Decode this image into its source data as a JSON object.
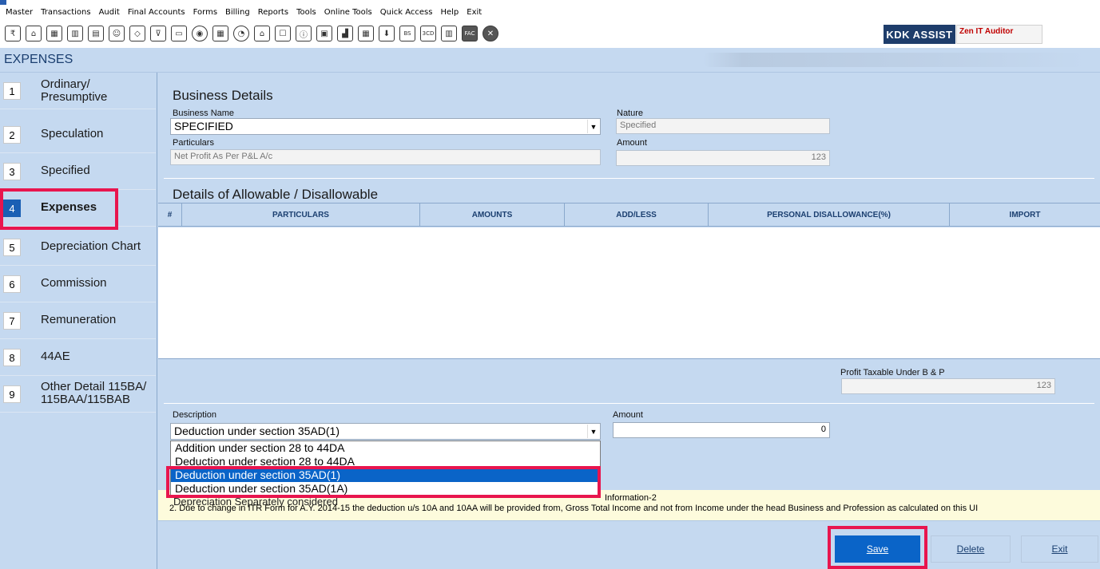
{
  "menu": [
    "Master",
    "Transactions",
    "Audit",
    "Final Accounts",
    "Forms",
    "Billing",
    "Reports",
    "Tools",
    "Online Tools",
    "Quick Access",
    "Help",
    "Exit"
  ],
  "toolbar": {
    "icons": [
      "rupee-icon",
      "home-icon",
      "grid-icon",
      "bar-chart-icon",
      "calendar-icon",
      "users-icon",
      "tag-icon",
      "filter-icon",
      "tax-icon",
      "disc-icon",
      "calculator-icon",
      "pie-icon",
      "pay-icon",
      "document-icon",
      "info-icon",
      "register-icon",
      "report-icon",
      "planner-icon",
      "download-icon",
      "bs-icon",
      "3cd-icon",
      "ledger-icon",
      "fac-icon",
      "close-circle-icon"
    ],
    "icon_glyphs": [
      "₹",
      "⌂",
      "▦",
      "▥",
      "▤",
      "☺",
      "◇",
      "⊽",
      "▭",
      "◉",
      "▦",
      "◔",
      "⌂",
      "☐",
      "ⓘ",
      "▣",
      "▟",
      "▦",
      "⬇",
      "BS",
      "3CD",
      "▥",
      "FAC",
      "✕"
    ],
    "kdk_assist": "KDK ASSIST",
    "zen_auditor": "Zen IT Auditor"
  },
  "page_title": "EXPENSES",
  "sidebar": {
    "items": [
      {
        "num": "1",
        "label": "Ordinary/ Presumptive"
      },
      {
        "num": "2",
        "label": "Speculation"
      },
      {
        "num": "3",
        "label": "Specified"
      },
      {
        "num": "4",
        "label": "Expenses"
      },
      {
        "num": "5",
        "label": "Depreciation Chart"
      },
      {
        "num": "6",
        "label": "Commission"
      },
      {
        "num": "7",
        "label": "Remuneration"
      },
      {
        "num": "8",
        "label": "44AE"
      },
      {
        "num": "9",
        "label": "Other Detail 115BA/ 115BAA/115BAB"
      }
    ]
  },
  "business": {
    "section_title": "Business Details",
    "name_label": "Business Name",
    "name_value": "SPECIFIED",
    "nature_label": "Nature",
    "nature_value": "Specified",
    "particulars_label": "Particulars",
    "particulars_value": "Net Profit As Per P&L A/c",
    "amount_label": "Amount",
    "amount_value": "123"
  },
  "allowable": {
    "section_title": "Details of Allowable / Disallowable",
    "columns": [
      "#",
      "PARTICULARS",
      "AMOUNTS",
      "ADD/LESS",
      "PERSONAL DISALLOWANCE(%)",
      "IMPORT"
    ]
  },
  "profit": {
    "label": "Profit Taxable Under B & P",
    "value": "123"
  },
  "description": {
    "label": "Description",
    "selected": "Deduction under section 35AD(1)",
    "amount_label": "Amount",
    "amount_value": "0",
    "options": [
      "Addition under section 28 to 44DA",
      "Deduction under section 28 to 44DA",
      "Deduction under section 35AD(1)",
      "Deduction under section 35AD(1A)"
    ]
  },
  "info": {
    "title": "Information-2",
    "line1": "Depreciation Separately considered",
    "line2": "2. Due to change in ITR Form for A.Y. 2014-15 the deduction u/s 10A and 10AA will be provided from, Gross Total Income and not from Income under the head Business and Profession as calculated on this UI"
  },
  "buttons": {
    "save": "Save",
    "delete": "Delete",
    "exit": "Exit"
  },
  "colors": {
    "accent": "#0a64c8",
    "highlight": "#e8154e",
    "panel": "#c5d9f0"
  }
}
